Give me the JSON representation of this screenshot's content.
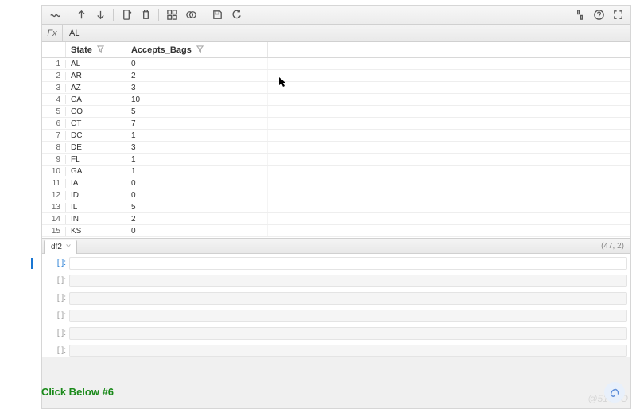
{
  "fx": {
    "label": "Fx",
    "value": "AL"
  },
  "columns": {
    "state": "State",
    "accepts_bags": "Accepts_Bags"
  },
  "rows": [
    {
      "n": 1,
      "state": "AL",
      "bags": 0
    },
    {
      "n": 2,
      "state": "AR",
      "bags": 2
    },
    {
      "n": 3,
      "state": "AZ",
      "bags": 3
    },
    {
      "n": 4,
      "state": "CA",
      "bags": 10
    },
    {
      "n": 5,
      "state": "CO",
      "bags": 5
    },
    {
      "n": 6,
      "state": "CT",
      "bags": 7
    },
    {
      "n": 7,
      "state": "DC",
      "bags": 1
    },
    {
      "n": 8,
      "state": "DE",
      "bags": 3
    },
    {
      "n": 9,
      "state": "FL",
      "bags": 1
    },
    {
      "n": 10,
      "state": "GA",
      "bags": 1
    },
    {
      "n": 11,
      "state": "IA",
      "bags": 0
    },
    {
      "n": 12,
      "state": "ID",
      "bags": 0
    },
    {
      "n": 13,
      "state": "IL",
      "bags": 5
    },
    {
      "n": 14,
      "state": "IN",
      "bags": 2
    },
    {
      "n": 15,
      "state": "KS",
      "bags": 0
    }
  ],
  "sheet": {
    "tab_label": "df2",
    "dimensions": "(47, 2)"
  },
  "cell_prompts": [
    "[  ]:",
    "[  ]:",
    "[  ]:",
    "[  ]:",
    "[  ]:",
    "[  ]:"
  ],
  "heading": "Click Below #6",
  "watermark": "@51CTO"
}
